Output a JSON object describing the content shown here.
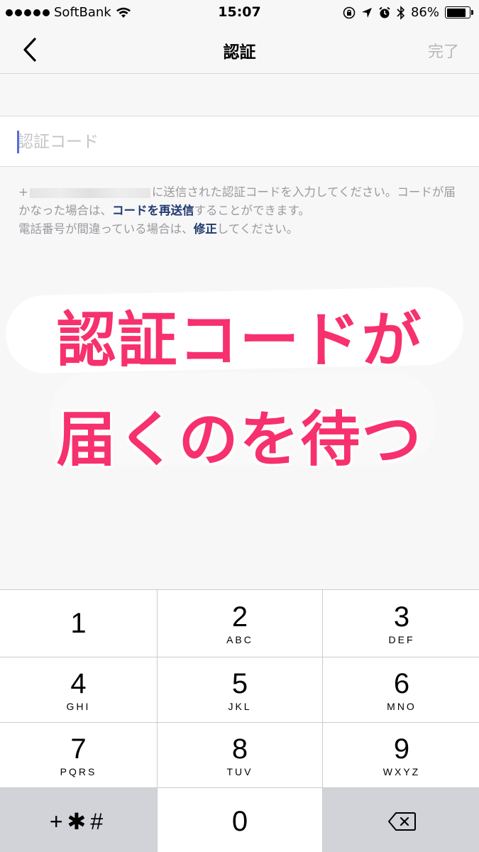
{
  "status_bar": {
    "carrier": "SoftBank",
    "time": "15:07",
    "battery_percent": "86%",
    "battery_level": 0.86,
    "icons": [
      "signal-dots-icon",
      "wifi-icon",
      "rotation-lock-icon",
      "location-icon",
      "alarm-icon",
      "bluetooth-icon",
      "battery-icon"
    ]
  },
  "nav": {
    "back_icon": "chevron-left-icon",
    "title": "認証",
    "done_label": "完了"
  },
  "code_input": {
    "placeholder": "認証コード",
    "value": ""
  },
  "info": {
    "phone_prefix": "+",
    "line1_after_phone": "に送信された認証コードを入力してください。コードが届かなった場合は、",
    "resend_link": "コードを再送信",
    "line2_tail": "することができます。",
    "line3_head": "電話番号が間違っている場合は、",
    "edit_link": "修正",
    "line3_tail": "してください。"
  },
  "overlay": {
    "line1": "認証コードが",
    "line2": "届くのを待つ",
    "color": "#f7306e"
  },
  "keypad": {
    "keys": [
      {
        "num": "1",
        "letters": ""
      },
      {
        "num": "2",
        "letters": "ABC"
      },
      {
        "num": "3",
        "letters": "DEF"
      },
      {
        "num": "4",
        "letters": "GHI"
      },
      {
        "num": "5",
        "letters": "JKL"
      },
      {
        "num": "6",
        "letters": "MNO"
      },
      {
        "num": "7",
        "letters": "PQRS"
      },
      {
        "num": "8",
        "letters": "TUV"
      },
      {
        "num": "9",
        "letters": "WXYZ"
      }
    ],
    "symbols": "+✱#",
    "zero": "0",
    "delete_icon": "backspace-icon"
  }
}
